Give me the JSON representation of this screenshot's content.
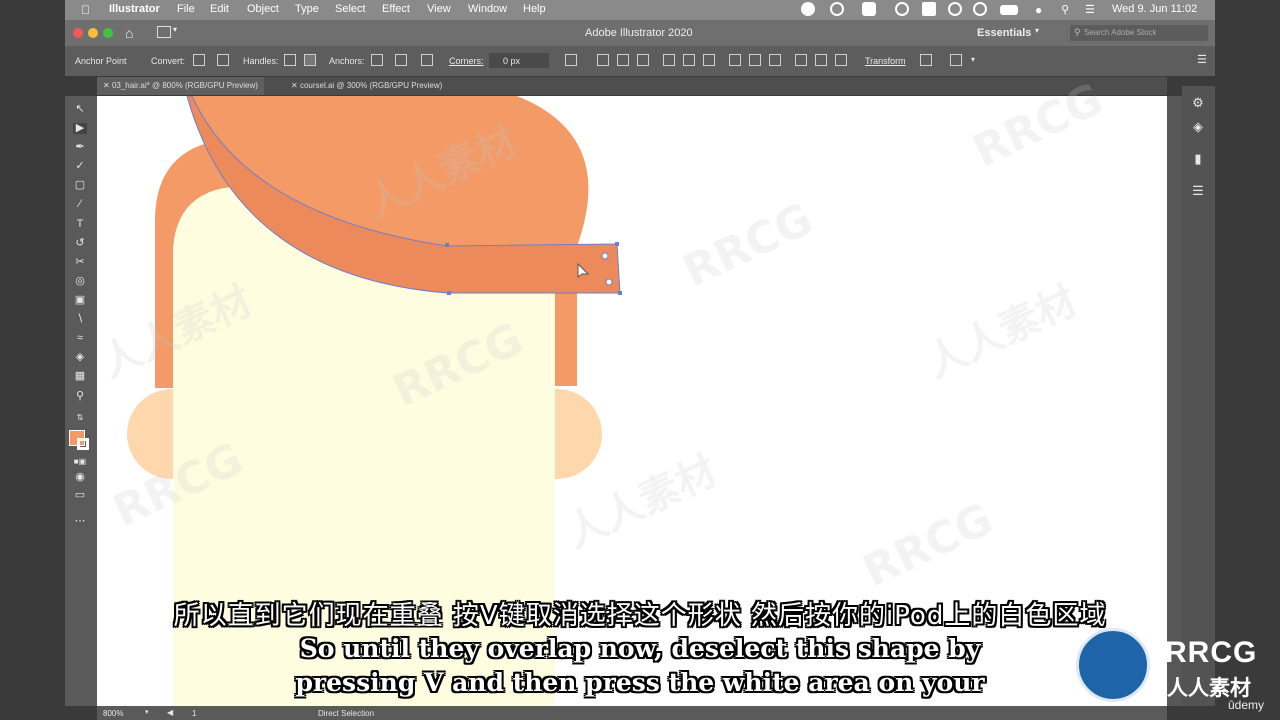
{
  "menubar": {
    "apple_icon": "apple-icon",
    "app_name": "Illustrator",
    "items": [
      "File",
      "Edit",
      "Object",
      "Type",
      "Select",
      "Effect",
      "View",
      "Window",
      "Help"
    ],
    "clock": "Wed 9. Jun  11:02"
  },
  "titlebar": {
    "title": "Adobe Illustrator 2020",
    "workspace": "Essentials",
    "search_placeholder": "Search Adobe Stock"
  },
  "controlbar": {
    "anchor_point": "Anchor Point",
    "convert": "Convert:",
    "handles": "Handles:",
    "anchors": "Anchors:",
    "corners": "Corners:",
    "corner_value": "0 px",
    "transform": "Transform"
  },
  "tabs": [
    {
      "label": "03_hair.ai* @ 800% (RGB/GPU Preview)",
      "active": true
    },
    {
      "label": "coursel.ai @ 300% (RGB/GPU Preview)",
      "active": false
    }
  ],
  "statusbar": {
    "zoom": "800%",
    "artboard": "1",
    "tool": "Direct Selection"
  },
  "subtitles": {
    "cn": "所以直到它们现在重叠 按V键取消选择这个形状 然后按你的iPod上的白色区域",
    "en1": "So until they overlap now, deselect this shape by",
    "en2": "pressing V and then press the white area on your"
  },
  "watermark": {
    "text": "RRCG",
    "cn": "人人素材"
  },
  "branding": {
    "logo_text": "RRCG",
    "logo_sub": "人人素材",
    "udemy": "ûdemy"
  },
  "colors": {
    "hair": "#f39a67",
    "hair_band": "#ec8a5c",
    "face": "#fffde0",
    "ear": "#ffd7ad"
  }
}
